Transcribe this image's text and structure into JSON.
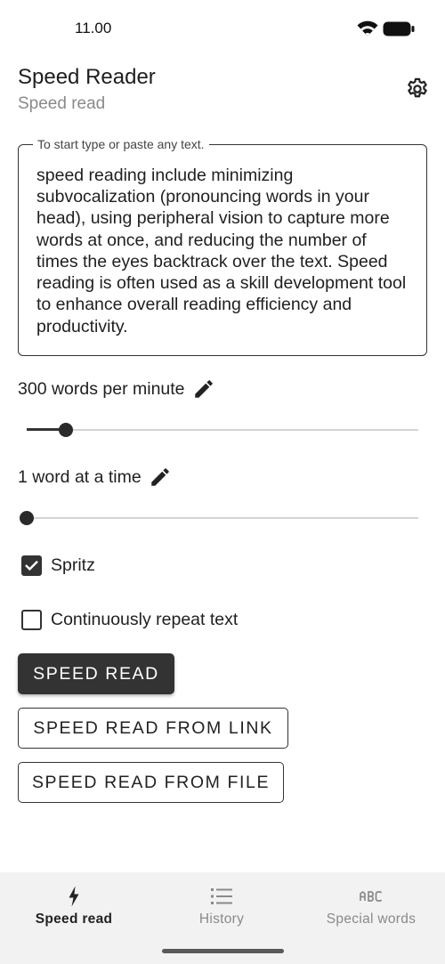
{
  "status_bar": {
    "time": "11.00"
  },
  "header": {
    "title": "Speed Reader",
    "subtitle": "Speed read"
  },
  "text_field": {
    "label": "To start type or paste any text.",
    "content": "speed reading include minimizing subvocalization (pronouncing words in your head), using peripheral vision to capture more words at once, and reducing the number of times the eyes backtrack over the text. Speed reading is often used as a skill development tool to enhance overall reading efficiency and productivity."
  },
  "speed": {
    "label": "300 words per minute",
    "slider_fraction": 0.1
  },
  "chunk": {
    "label": "1 word at a time",
    "slider_fraction": 0.0
  },
  "checkboxes": [
    {
      "label": "Spritz",
      "checked": true
    },
    {
      "label": "Continuously repeat text",
      "checked": false
    }
  ],
  "buttons": {
    "speed_read": "SPEED READ",
    "from_link": "SPEED READ FROM LINK",
    "from_file": "SPEED READ FROM FILE"
  },
  "bottom_nav": {
    "items": [
      {
        "label": "Speed read",
        "icon": "bolt-icon",
        "active": true
      },
      {
        "label": "History",
        "icon": "list-icon",
        "active": false
      },
      {
        "label": "Special words",
        "icon": "abc-icon",
        "active": false
      }
    ]
  },
  "colors": {
    "primary": "#333333",
    "nav_background": "#f2f2f2",
    "muted_text": "#8a8a8a"
  }
}
